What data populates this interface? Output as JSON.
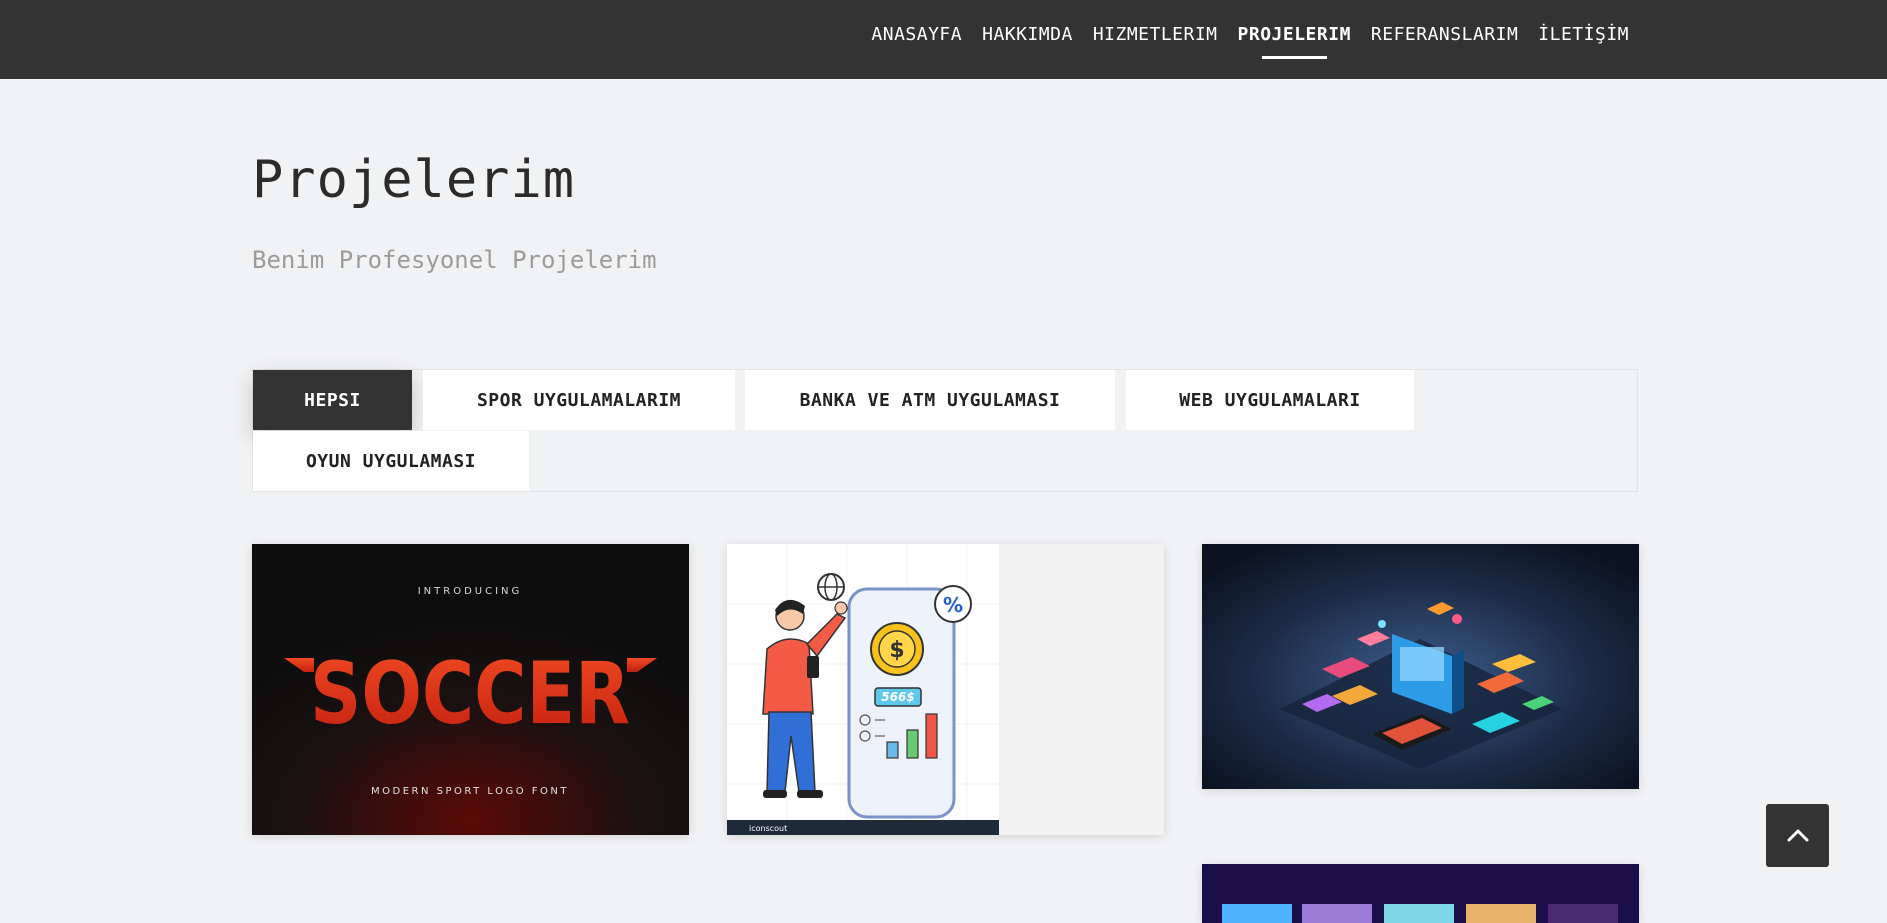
{
  "nav": {
    "items": [
      {
        "label": "ANASAYFA",
        "active": false
      },
      {
        "label": "HAKKIMDA",
        "active": false
      },
      {
        "label": "HIZMETLERIM",
        "active": false
      },
      {
        "label": "PROJELERIM",
        "active": true
      },
      {
        "label": "REFERANSLARIM",
        "active": false
      },
      {
        "label": "İLETİŞİM",
        "active": false
      }
    ]
  },
  "page": {
    "title": "Projelerim",
    "subtitle": "Benim Profesyonel Projelerim"
  },
  "filters": [
    {
      "label": "HEPSI",
      "active": true
    },
    {
      "label": "SPOR UYGULAMALARIM",
      "active": false
    },
    {
      "label": "BANKA VE ATM UYGULAMASI",
      "active": false
    },
    {
      "label": "WEB UYGULAMALARI",
      "active": false
    },
    {
      "label": "OYUN UYGULAMASI",
      "active": false
    }
  ],
  "projects": [
    {
      "image": "soccer-font-image",
      "intro": "INTRODUCING",
      "headline": "SOCCER",
      "tagline": "MODERN SPORT LOGO FONT"
    },
    {
      "image": "banking-app-illustration",
      "amount": "566$",
      "badge": "%",
      "brand": "iconscout"
    },
    {
      "image": "isometric-apps-image"
    },
    {
      "image": "game-app-image"
    }
  ],
  "scroll_top": {
    "icon": "chevron-up-icon"
  },
  "colors": {
    "navbar": "#333333",
    "background": "#f1f2f4",
    "soccer_red": "#e03a1e"
  }
}
